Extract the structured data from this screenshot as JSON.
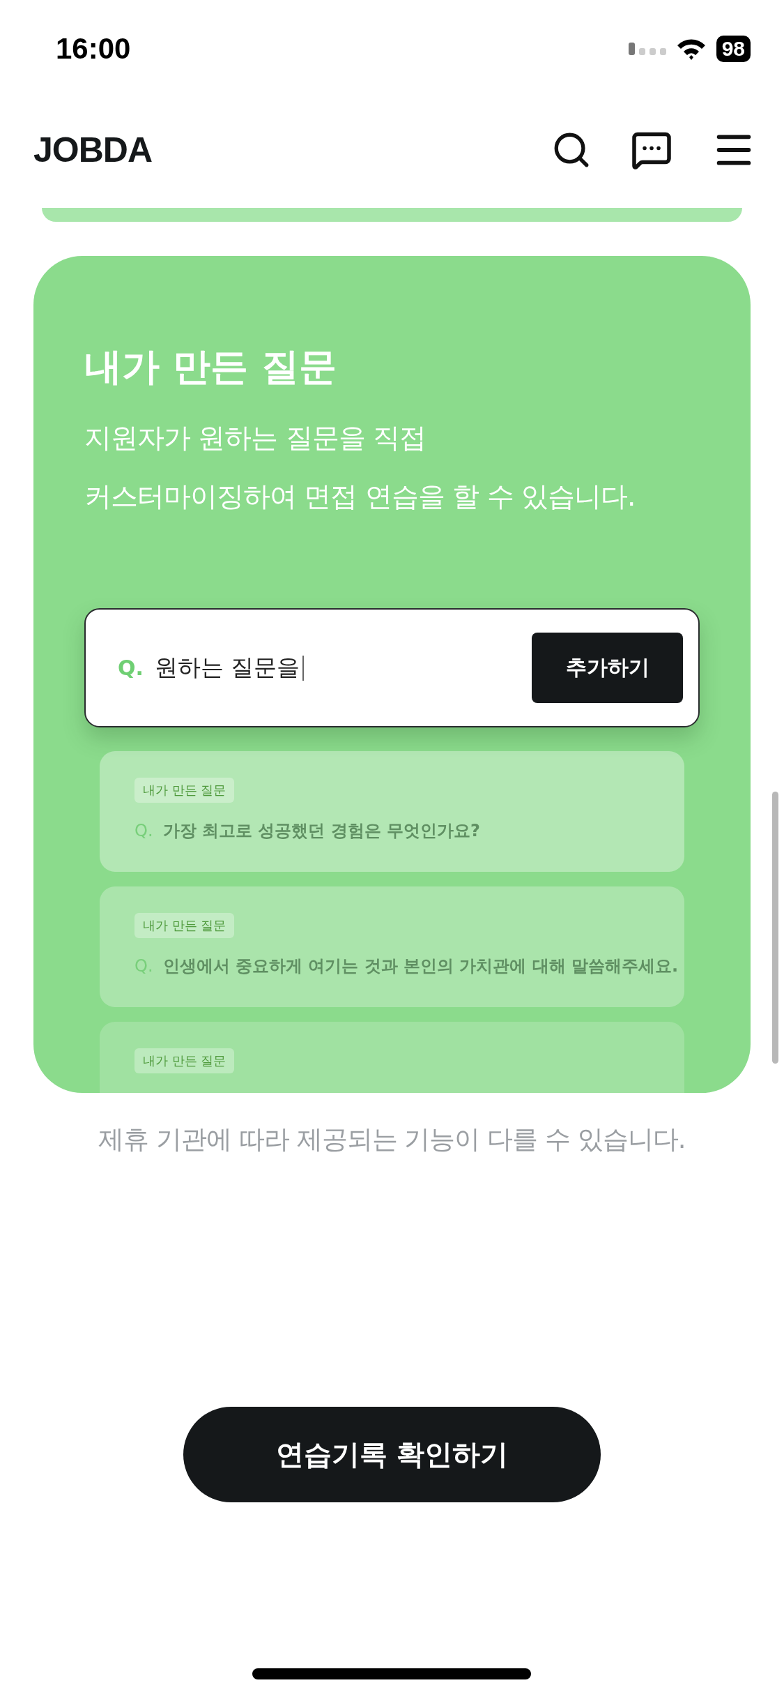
{
  "status_bar": {
    "time": "16:00",
    "battery": "98"
  },
  "header": {
    "logo": "JOBDA"
  },
  "feature_card": {
    "title": "내가 만든 질문",
    "description": [
      "지원자가 원하는 질문을 직접",
      "커스터마이징하여 면접 연습을 할 수 있습니다."
    ],
    "question_input": {
      "prefix": "Q.",
      "value": "원하는 질문을",
      "button": "추가하기"
    },
    "questions": [
      {
        "tag": "내가 만든 질문",
        "prefix": "Q.",
        "text": "가장 최고로 성공했던 경험은 무엇인가요?"
      },
      {
        "tag": "내가 만든 질문",
        "prefix": "Q.",
        "text": "인생에서 중요하게 여기는 것과 본인의 가치관에 대해 말씀해주세요."
      },
      {
        "tag": "내가 만든 질문"
      }
    ]
  },
  "note": "제휴 기관에 따라 제공되는 기능이 다를 수 있습니다.",
  "practice_button": "연습기록 확인하기"
}
